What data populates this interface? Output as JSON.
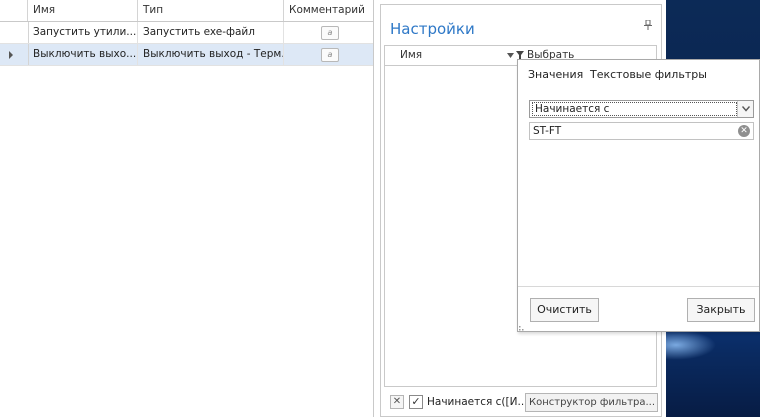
{
  "grid": {
    "columns": [
      "Имя",
      "Тип",
      "Комментарий"
    ],
    "rows": [
      {
        "name": "Запустить утили...",
        "type": "Запустить exe-файл",
        "comment_icon": "memo-icon",
        "selected": false
      },
      {
        "name": "Выключить выхо...",
        "type": "Выключить выход - Терм...",
        "comment_icon": "memo-icon",
        "selected": true
      }
    ],
    "memo_glyph": "a"
  },
  "settings": {
    "title": "Настройки",
    "pin_icon": "pin-icon",
    "column_name": "Имя",
    "select_column": "Выбрать",
    "filter_status": {
      "enabled": true,
      "text": "Начинается с([И...",
      "constructor_button": "Конструктор фильтра..."
    }
  },
  "popup": {
    "tabs": [
      "Значения",
      "Текстовые фильтры"
    ],
    "active_tab": "Текстовые фильтры",
    "operator": "Начинается с",
    "value": "ST-FT",
    "clear_button": "Очистить",
    "close_button": "Закрыть"
  },
  "colors": {
    "title_blue": "#2e78c7",
    "selected_row": "#dde8f6"
  }
}
